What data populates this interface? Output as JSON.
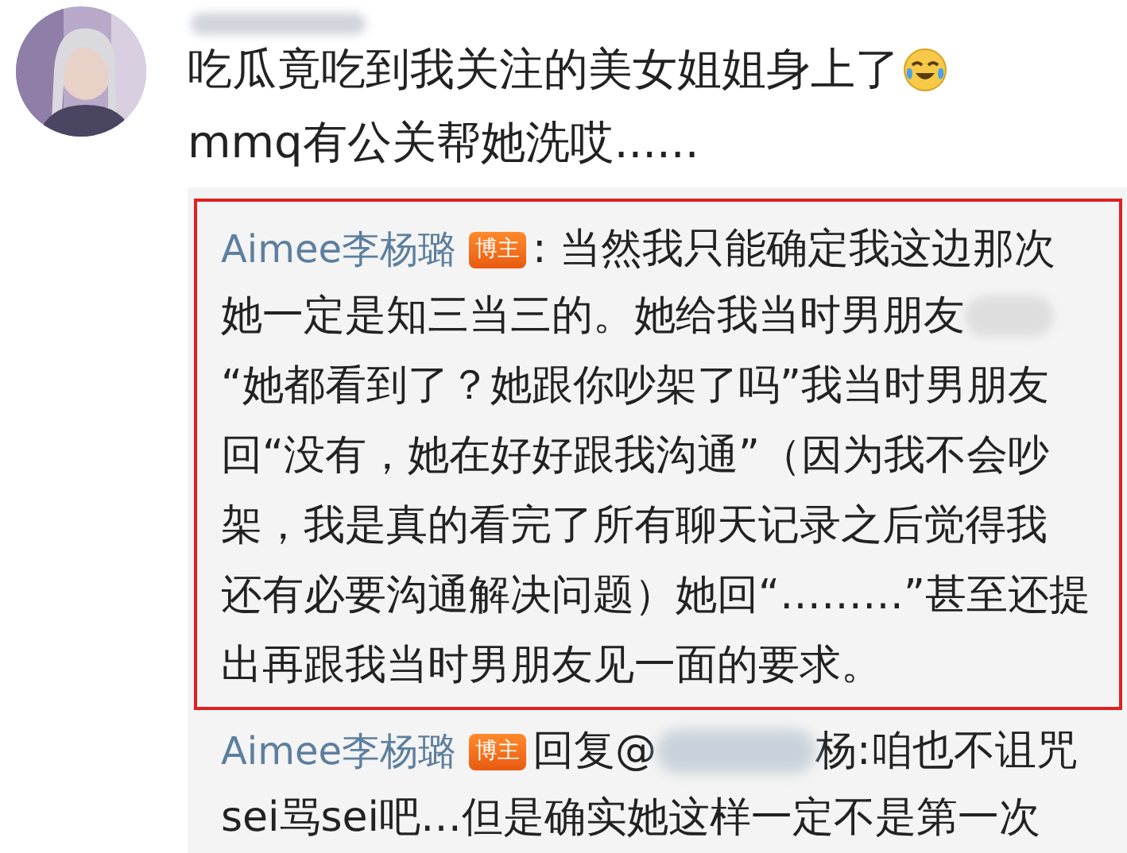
{
  "comment": {
    "lines": [
      "吃瓜竟吃到我关注的美女姐姐身上了",
      "mmq有公关帮她洗哎......"
    ]
  },
  "replies": [
    {
      "author": "Aimee李杨璐",
      "badge": "博主",
      "highlighted": true,
      "first": ": 当然我只能确定我这边那次",
      "lines": [
        "她一定是知三当三的。她给我当时男朋友",
        "“她都看到了？她跟你吵架了吗”我当时男朋友",
        "回“没有，她在好好跟我沟通”（因为我不会吵",
        "架，我是真的看完了所有聊天记录之后觉得我",
        "还有必要沟通解决问题）她回“………”甚至还提",
        "出再跟我当时男朋友见一面的要求。"
      ]
    },
    {
      "author": "Aimee李杨璐",
      "badge": "博主",
      "highlighted": false,
      "first": "回复@",
      "mention_end": "杨:咱也不诅咒",
      "lines": [
        "sei骂sei吧…但是确实她这样一定不是第一次"
      ]
    }
  ]
}
